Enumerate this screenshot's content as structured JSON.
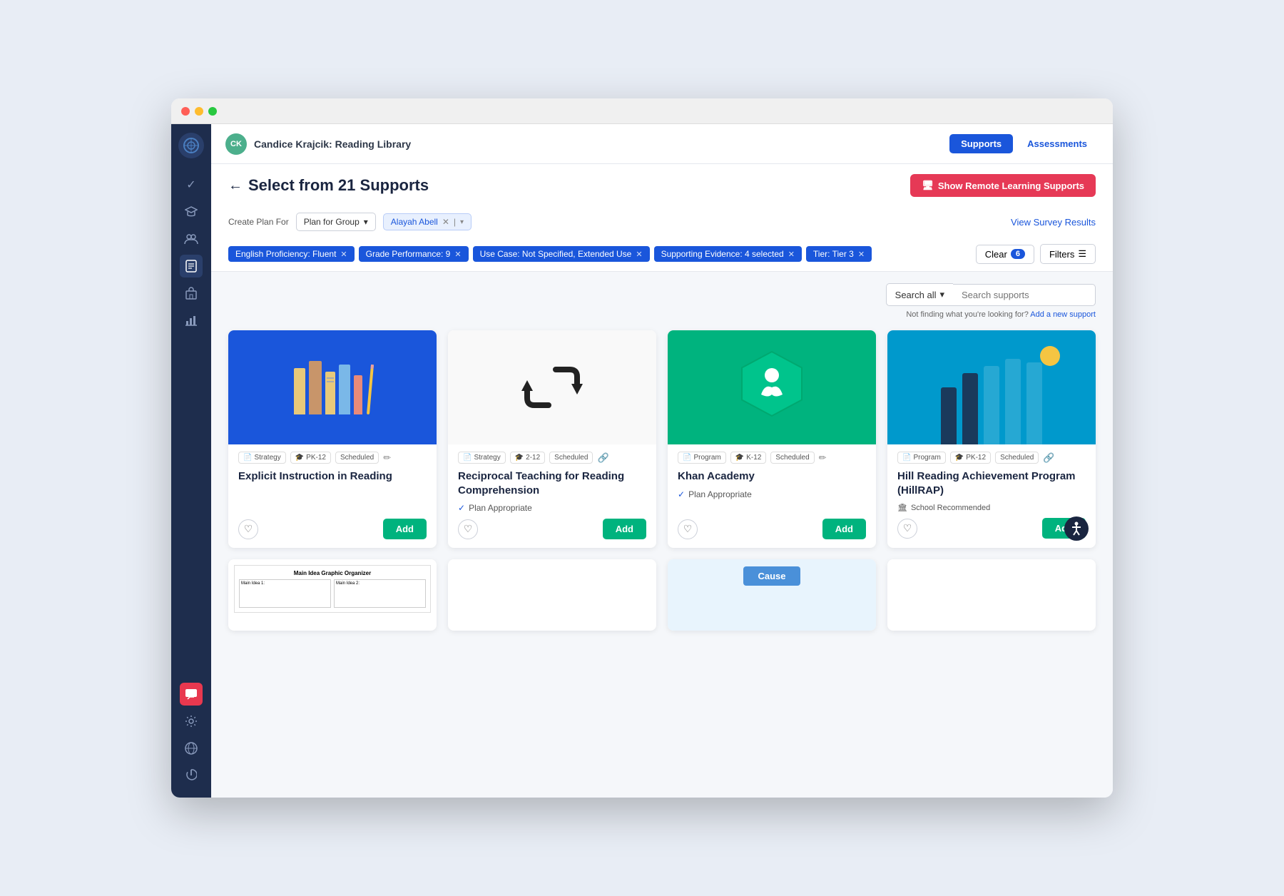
{
  "browser": {
    "dots": [
      "red",
      "yellow",
      "green"
    ]
  },
  "nav": {
    "avatar_initials": "CK",
    "title": "Candice Krajcik: Reading Library",
    "supports_btn": "Supports",
    "assessments_btn": "Assessments"
  },
  "page": {
    "back_label": "←",
    "title": "Select from 21 Supports",
    "remote_btn_icon": "🖥",
    "remote_btn_label": "Show Remote Learning Supports"
  },
  "filter": {
    "create_label": "Create Plan For",
    "plan_value": "Plan for Group",
    "student_name": "Alayah Abell",
    "view_survey_label": "View Survey Results"
  },
  "tags": [
    {
      "label": "English Proficiency: Fluent"
    },
    {
      "label": "Grade Performance: 9"
    },
    {
      "label": "Use Case: Not Specified, Extended Use"
    },
    {
      "label": "Supporting Evidence: 4 selected"
    },
    {
      "label": "Tier: Tier 3"
    }
  ],
  "tag_actions": {
    "clear_label": "Clear",
    "clear_count": "6",
    "filters_label": "Filters"
  },
  "search": {
    "search_all_label": "Search all",
    "search_all_caret": "▾",
    "placeholder": "Search supports",
    "not_finding": "Not finding what you're looking for?",
    "add_link": "Add a new support"
  },
  "cards": [
    {
      "id": "explicit-instruction",
      "image_type": "books",
      "image_bg": "blue-bg",
      "meta": [
        {
          "icon": "📄",
          "label": "Strategy"
        },
        {
          "icon": "🎓",
          "label": "PK-12"
        },
        {
          "icon": "📅",
          "label": "Scheduled"
        }
      ],
      "title": "Explicit Instruction in Reading",
      "plan_appropriate": false,
      "school_recommended": false,
      "edit": true
    },
    {
      "id": "reciprocal-teaching",
      "image_type": "repeat",
      "image_bg": "white-bg",
      "meta": [
        {
          "icon": "📄",
          "label": "Strategy"
        },
        {
          "icon": "🎓",
          "label": "2-12"
        },
        {
          "icon": "📅",
          "label": "Scheduled"
        }
      ],
      "title": "Reciprocal Teaching for Reading Comprehension",
      "plan_appropriate": true,
      "school_recommended": false,
      "edit": true
    },
    {
      "id": "khan-academy",
      "image_type": "khan",
      "image_bg": "green-bg",
      "meta": [
        {
          "icon": "📄",
          "label": "Program"
        },
        {
          "icon": "🎓",
          "label": "K-12"
        },
        {
          "icon": "📅",
          "label": "Scheduled"
        }
      ],
      "title": "Khan Academy",
      "plan_appropriate": true,
      "school_recommended": false,
      "edit": true
    },
    {
      "id": "hill-rap",
      "image_type": "hill",
      "image_bg": "teal-bg",
      "meta": [
        {
          "icon": "📄",
          "label": "Program"
        },
        {
          "icon": "🎓",
          "label": "PK-12"
        },
        {
          "icon": "📅",
          "label": "Scheduled"
        }
      ],
      "title": "Hill Reading Achievement Program (HillRAP)",
      "plan_appropriate": false,
      "school_recommended": true,
      "edit": true
    }
  ],
  "sidebar": {
    "icons": [
      {
        "name": "globe",
        "char": "🌐",
        "active": false
      },
      {
        "name": "check",
        "char": "✓",
        "active": false
      },
      {
        "name": "graduate",
        "char": "🎓",
        "active": false
      },
      {
        "name": "group",
        "char": "👥",
        "active": false
      },
      {
        "name": "document",
        "char": "📋",
        "active": true
      },
      {
        "name": "building",
        "char": "🏛",
        "active": false
      },
      {
        "name": "chart",
        "char": "📊",
        "active": false
      }
    ],
    "bottom_icons": [
      {
        "name": "chat",
        "char": "💬",
        "highlight": true
      },
      {
        "name": "gear",
        "char": "⚙"
      },
      {
        "name": "globe2",
        "char": "🌍"
      },
      {
        "name": "power",
        "char": "⏻"
      }
    ]
  }
}
